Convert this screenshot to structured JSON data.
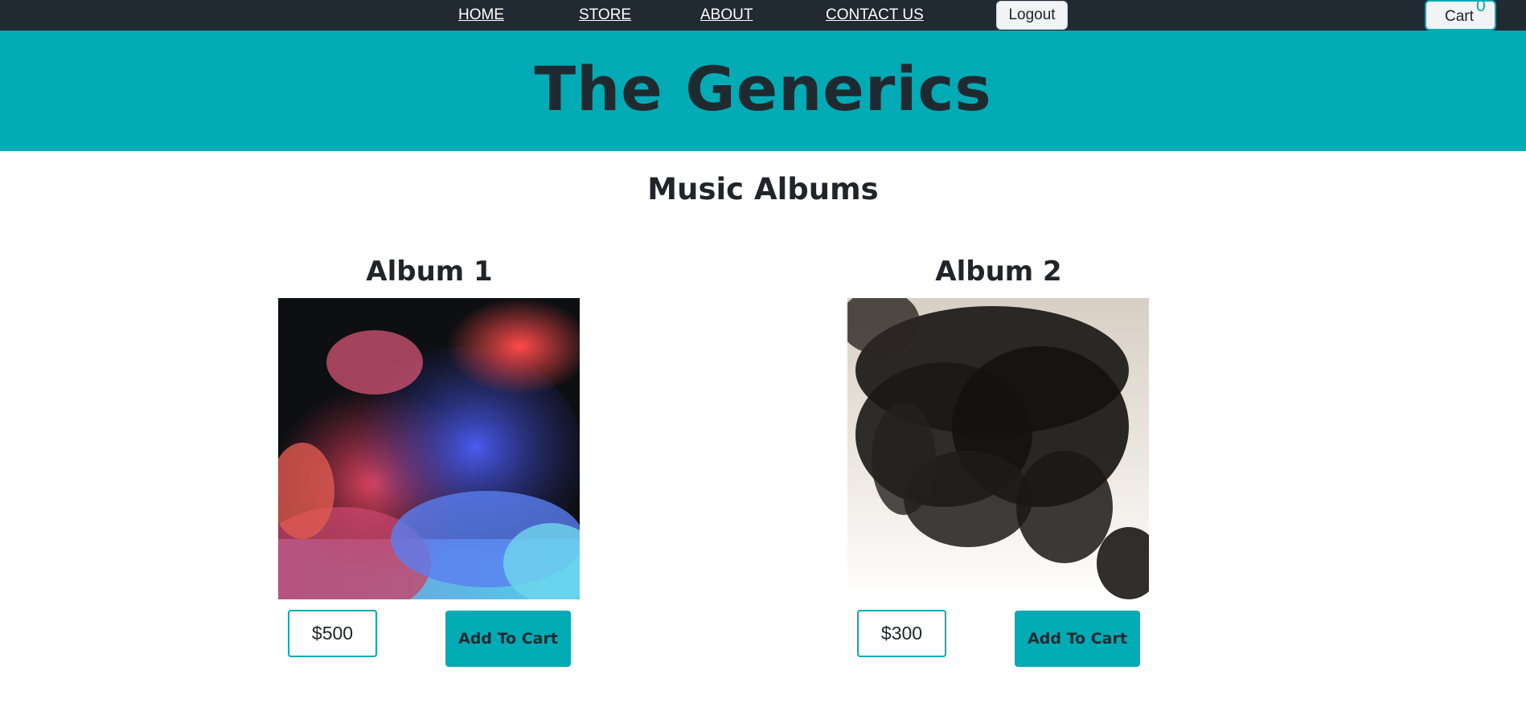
{
  "nav": {
    "links": [
      "HOME",
      "STORE",
      "ABOUT",
      "CONTACT US"
    ],
    "logout_label": "Logout",
    "cart_label": "Cart",
    "cart_count": "0"
  },
  "banner": {
    "title": "The Generics"
  },
  "main": {
    "section_title": "Music Albums",
    "albums": [
      {
        "title": "Album 1",
        "price": "$500",
        "add_label": "Add To Cart"
      },
      {
        "title": "Album 2",
        "price": "$300",
        "add_label": "Add To Cart"
      }
    ]
  },
  "colors": {
    "navbar_bg": "#212933",
    "accent": "#00abb5",
    "text_dark": "#212529"
  }
}
